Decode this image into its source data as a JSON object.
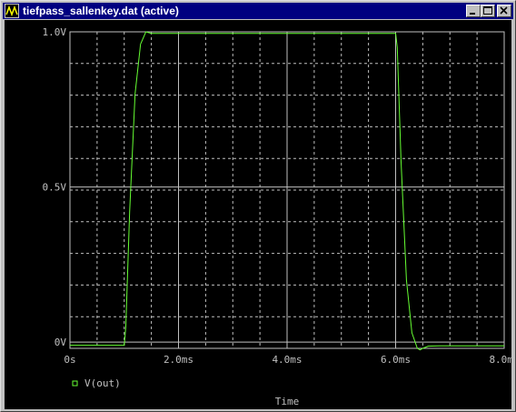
{
  "window": {
    "title": "tiefpass_sallenkey.dat (active)",
    "buttons": [
      "minimize",
      "maximize",
      "close"
    ]
  },
  "colors": {
    "background": "#000000",
    "grid": "#c0c0c0",
    "trace": "#66ff33",
    "titlebar": "#000080"
  },
  "chart_data": {
    "type": "line",
    "xlabel": "Time",
    "ylabel": "",
    "xlim": [
      0,
      8.0
    ],
    "ylim": [
      -0.02,
      1.0
    ],
    "x_unit": "ms",
    "x_ticks": [
      0,
      2.0,
      4.0,
      6.0,
      8.0
    ],
    "x_tick_labels": [
      "0s",
      "2.0ms",
      "4.0ms",
      "6.0ms",
      "8.0ms"
    ],
    "y_ticks": [
      0,
      0.5,
      1.0
    ],
    "y_tick_labels": [
      "0V",
      "0.5V",
      "1.0V"
    ],
    "grid": true,
    "legend_position": "bottom-left",
    "series": [
      {
        "name": "V(out)",
        "x": [
          0,
          1.0,
          1.03,
          1.1,
          1.2,
          1.3,
          1.4,
          1.5,
          1.7,
          2.0,
          3.0,
          4.0,
          5.0,
          6.0,
          6.03,
          6.1,
          6.2,
          6.3,
          6.4,
          6.45,
          6.5,
          6.6,
          6.8,
          7.0,
          8.0
        ],
        "y": [
          -0.01,
          -0.01,
          0.05,
          0.42,
          0.8,
          0.96,
          1.0,
          0.995,
          0.995,
          0.995,
          0.995,
          0.995,
          0.995,
          0.995,
          0.95,
          0.58,
          0.2,
          0.03,
          -0.02,
          -0.025,
          -0.02,
          -0.013,
          -0.012,
          -0.012,
          -0.012
        ]
      }
    ]
  }
}
